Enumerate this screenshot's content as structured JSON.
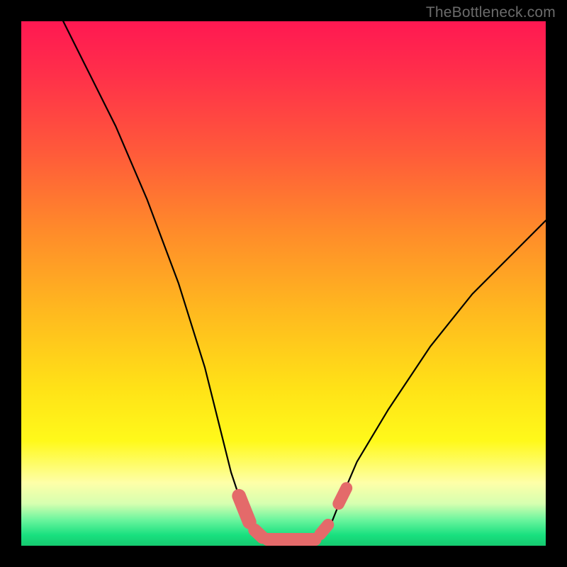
{
  "watermark": "TheBottleneck.com",
  "chart_data": {
    "type": "line",
    "title": "",
    "xlabel": "",
    "ylabel": "",
    "xlim": [
      0,
      100
    ],
    "ylim": [
      0,
      100
    ],
    "series": [
      {
        "name": "bottleneck-curve",
        "x": [
          8,
          12,
          18,
          24,
          30,
          35,
          38,
          40,
          42,
          44,
          46,
          49,
          52,
          55,
          57,
          59,
          61,
          64,
          70,
          78,
          86,
          94,
          100
        ],
        "y": [
          100,
          92,
          80,
          66,
          50,
          34,
          22,
          14,
          8,
          4,
          2,
          1,
          1,
          1,
          2,
          4,
          9,
          16,
          26,
          38,
          48,
          56,
          62
        ]
      }
    ],
    "markers": [
      {
        "name": "segment-a",
        "x1": 41.5,
        "y1": 9.5,
        "x2": 43.5,
        "y2": 4.5,
        "thickness": 2.8
      },
      {
        "name": "segment-b",
        "x1": 44.5,
        "y1": 3.0,
        "x2": 46.0,
        "y2": 1.6,
        "thickness": 2.6
      },
      {
        "name": "segment-c",
        "x1": 47.0,
        "y1": 1.2,
        "x2": 56.0,
        "y2": 1.2,
        "thickness": 2.6
      },
      {
        "name": "segment-d",
        "x1": 57.0,
        "y1": 2.2,
        "x2": 58.5,
        "y2": 4.0,
        "thickness": 2.4
      },
      {
        "name": "segment-e",
        "x1": 60.5,
        "y1": 8.0,
        "x2": 62.0,
        "y2": 11.0,
        "thickness": 2.4
      }
    ],
    "colors": {
      "curve": "#000000",
      "marker": "#e46a6a",
      "gradient_top": "#ff1852",
      "gradient_bottom": "#16c96f"
    }
  }
}
